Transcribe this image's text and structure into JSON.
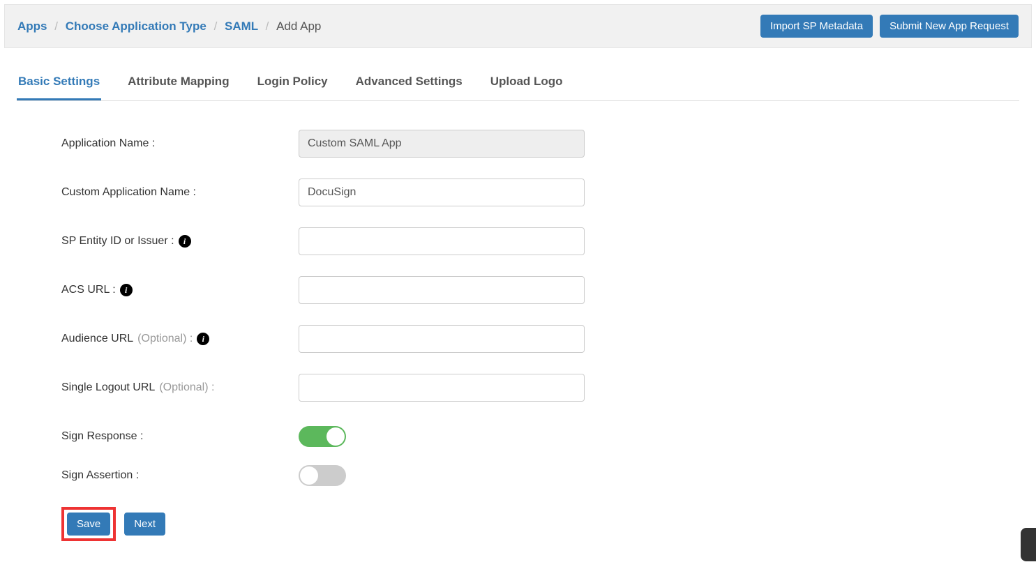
{
  "breadcrumb": {
    "items": [
      "Apps",
      "Choose Application Type",
      "SAML"
    ],
    "current": "Add App"
  },
  "topActions": {
    "importMetadata": "Import SP Metadata",
    "submitRequest": "Submit New App Request"
  },
  "tabs": [
    {
      "label": "Basic Settings",
      "active": true
    },
    {
      "label": "Attribute Mapping",
      "active": false
    },
    {
      "label": "Login Policy",
      "active": false
    },
    {
      "label": "Advanced Settings",
      "active": false
    },
    {
      "label": "Upload Logo",
      "active": false
    }
  ],
  "form": {
    "appNameLabel": "Application Name :",
    "appNameValue": "Custom SAML App",
    "customAppNameLabel": "Custom Application Name :",
    "customAppNameValue": "DocuSign",
    "spEntityLabel": "SP Entity ID or Issuer :",
    "spEntityValue": "",
    "acsUrlLabel": "ACS URL :",
    "acsUrlValue": "",
    "audienceUrlLabel": "Audience URL",
    "audienceUrlOptional": "(Optional) :",
    "audienceUrlValue": "",
    "sloUrlLabel": "Single Logout URL",
    "sloUrlOptional": "(Optional) :",
    "sloUrlValue": "",
    "signResponseLabel": "Sign Response :",
    "signResponseOn": true,
    "signAssertionLabel": "Sign Assertion :",
    "signAssertionOn": false
  },
  "actions": {
    "save": "Save",
    "next": "Next"
  }
}
